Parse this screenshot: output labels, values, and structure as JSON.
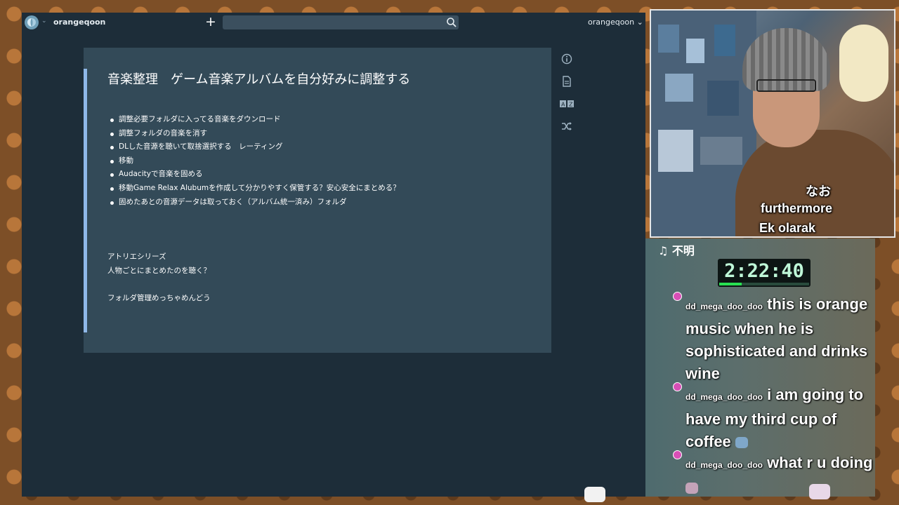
{
  "app": {
    "username": "orangeqoon",
    "account_menu_label": "orangeqoon",
    "search_placeholder": ""
  },
  "note": {
    "title": "音楽整理　ゲーム音楽アルバムを自分好みに調整する",
    "bullets": [
      "調整必要フォルダに入ってる音楽をダウンロード",
      "調整フォルダの音楽を消す",
      "DLした音源を聴いて取捨選択する　レーティング",
      "移動",
      "Audacityで音楽を固める",
      "移動Game Relax Alubumを作成して分かりやすく保管する？安心安全にまとめる？",
      "固めたあとの音源データは取っておく（アルバム統一済み）フォルダ"
    ],
    "para1": "アトリエシリーズ",
    "para2": "人物ごとにまとめたのを聴く？",
    "para3": "フォルダ管理めっちゃめんどう"
  },
  "tools": {
    "info_icon": "info-icon",
    "document_icon": "document-icon",
    "translate_icon": "translate-icon",
    "shuffle_icon": "shuffle-icon"
  },
  "stream": {
    "subtitles": [
      "なお",
      "furthermore",
      "Ek olarak"
    ],
    "now_playing": "♫ 不明",
    "timer": "2:22:40",
    "timer_progress": 0.25,
    "chat": [
      {
        "user": "dd_mega_doo_doo",
        "message": "this is orange music when he is sophisticated and drinks wine"
      },
      {
        "user": "dd_mega_doo_doo",
        "message": "i am going to have my third cup of coffee"
      },
      {
        "user": "dd_mega_doo_doo",
        "message": "what r u doing"
      }
    ]
  },
  "colors": {
    "app_bg": "#1d2d39",
    "note_bg": "#334a58",
    "note_accent": "#8fb8e8",
    "timer_green": "#29e052",
    "chat_badge": "#d84fb6"
  }
}
